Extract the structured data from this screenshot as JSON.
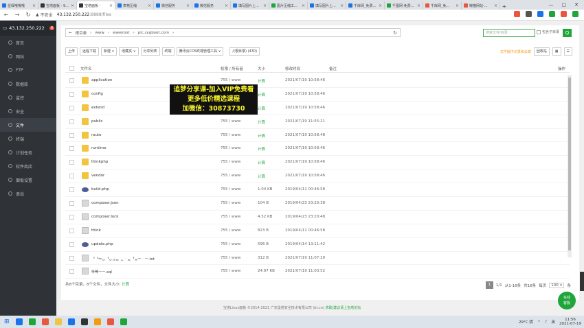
{
  "browser": {
    "tabs": [
      {
        "title": "星辉哦哦哦",
        "color": "#1a73e8"
      },
      {
        "title": "宝塔面板 - 9...",
        "color": "#333333"
      },
      {
        "title": "宝塔面板 - ",
        "color": "#333333",
        "active": true
      },
      {
        "title": "表格压缩",
        "color": "#1a73e8"
      },
      {
        "title": "微信服务",
        "color": "#1a73e8"
      },
      {
        "title": "微信服务",
        "color": "#1a73e8"
      },
      {
        "title": "填写图片上...",
        "color": "#1a73e8"
      },
      {
        "title": "图片压缩工...",
        "color": "#20a53a"
      },
      {
        "title": "填写图片上...",
        "color": "#1a73e8"
      },
      {
        "title": "千库网_免费...",
        "color": "#1a73e8"
      },
      {
        "title": "千图网-免费...",
        "color": "#20a53a"
      },
      {
        "title": "千库网_免...",
        "color": "#e9573f"
      },
      {
        "title": "懒猫网站-...",
        "color": "#e9573f"
      }
    ],
    "new_tab": "+",
    "win": {
      "min": "—",
      "max": "▢",
      "close": "✕"
    },
    "insecure_label": "不安全",
    "url_host": "43.132.250.222",
    "url_rest": ":8888/files",
    "ext_colors": [
      "#e9573f",
      "#555555",
      "#1a73e8",
      "#20a53a",
      "#e9573f",
      "#20a53a"
    ]
  },
  "sidebar": {
    "server": "43.132.250.222",
    "badge": "0",
    "items": [
      {
        "label": "首页"
      },
      {
        "label": "网站"
      },
      {
        "label": "FTP"
      },
      {
        "label": "数据库"
      },
      {
        "label": "监控"
      },
      {
        "label": "安全"
      },
      {
        "label": "文件",
        "active": true
      },
      {
        "label": "终端"
      },
      {
        "label": "计划任务"
      },
      {
        "label": "软件商店"
      },
      {
        "label": "面板设置"
      },
      {
        "label": "退出"
      }
    ]
  },
  "path": {
    "back": "←",
    "segments": [
      "根目录",
      "www",
      "wwwroot",
      "pic.zygboot.com"
    ],
    "sep": "›",
    "refresh": "↻"
  },
  "search": {
    "placeholder": "搜索文件/目录",
    "subdir_label": "包含子目录",
    "btn": "Q"
  },
  "toolbar": {
    "buttons": [
      "上传",
      "远程下载",
      "新建 ∨",
      "收藏夹 ∨",
      "分享列表",
      "终端",
      "腾讯云COS终端管理工具 ∨",
      "/(根目录) (430)"
    ],
    "fav_link": "文件操作记录和云端",
    "recycle": "回收站",
    "view_grid": "▦",
    "view_list": "☰"
  },
  "columns": {
    "name": "文件名",
    "perm": "权限 / 所有者",
    "size": "大小",
    "mtime": "修改时间",
    "note": "备注",
    "ops": "操作"
  },
  "files": [
    {
      "name": "application",
      "type": "folder",
      "perm": "755 / www",
      "size": "计算",
      "mtime": "2021/07/19 10:58:46"
    },
    {
      "name": "config",
      "type": "folder",
      "perm": "755 / www",
      "size": "计算",
      "mtime": "2021/07/19 10:58:46"
    },
    {
      "name": "extend",
      "type": "folder",
      "perm": "755 / www",
      "size": "计算",
      "mtime": "2021/07/19 10:58:46"
    },
    {
      "name": "public",
      "type": "folder",
      "perm": "755 / www",
      "size": "计算",
      "mtime": "2021/07/19 11:55:21"
    },
    {
      "name": "route",
      "type": "folder",
      "perm": "755 / www",
      "size": "计算",
      "mtime": "2021/07/19 10:58:48"
    },
    {
      "name": "runtime",
      "type": "folder",
      "perm": "755 / www",
      "size": "计算",
      "mtime": "2021/07/19 10:58:46"
    },
    {
      "name": "thinkphp",
      "type": "folder",
      "perm": "755 / www",
      "size": "计算",
      "mtime": "2021/07/19 10:58:46"
    },
    {
      "name": "vendor",
      "type": "folder",
      "perm": "755 / www",
      "size": "计算",
      "mtime": "2021/07/19 10:58:46"
    },
    {
      "name": "build.php",
      "type": "php",
      "perm": "755 / www",
      "size": "1.04 KB",
      "mtime": "2019/04/11 00:46:58"
    },
    {
      "name": "composer.json",
      "type": "file",
      "perm": "755 / www",
      "size": "104 B",
      "mtime": "2019/04/23 23:20:38"
    },
    {
      "name": "composer.lock",
      "type": "file",
      "perm": "755 / www",
      "size": "4.52 KB",
      "mtime": "2019/04/23 23:20:48"
    },
    {
      "name": "think",
      "type": "file",
      "perm": "755 / www",
      "size": "823 B",
      "mtime": "2019/04/11 00:46:58"
    },
    {
      "name": "update.php",
      "type": "php",
      "perm": "755 / www",
      "size": "596 B",
      "mtime": "2019/04/14 13:11:42"
    },
    {
      "name": "ᅡᅧᆃᆼᅥᆼᆭᆮ ᆫᆞᆮᅥᆾᅮᆞᅳ.txt",
      "type": "file",
      "perm": "755 / www",
      "size": "312 B",
      "mtime": "2021/07/19 11:07:20"
    },
    {
      "name": "ᅆᅡ빠ᅳᅳ.sql",
      "type": "file",
      "perm": "755 / www",
      "size": "24.97 KB",
      "mtime": "2021/07/19 11:03:52"
    }
  ],
  "footer": {
    "summary": "共8个目录，8个文件，文件大小: ",
    "calc": "计算",
    "page_current": "1",
    "page_total": "1/1",
    "range": "从1-16条",
    "count": "共16条",
    "per_page_label": "每页",
    "per_page": "100 ∨",
    "unit": "条"
  },
  "copyright": {
    "text": "宝塔Linux面板 ©2014-2021 广东堡塔安全技术有限公司 (bt.cn)",
    "link": "求助|建议请上宝塔论坛"
  },
  "promo": {
    "line1": "追梦分享课-加入VIP免费看",
    "line2": "更多低价精选课程",
    "line3": "加微信：30873730"
  },
  "online": {
    "line1": "在线",
    "line2": "客服"
  },
  "taskbar": {
    "icons": [
      "#1a73e8",
      "#20a53a",
      "#e9573f",
      "#f3c441",
      "#1a73e8",
      "#333333",
      "#f39c12",
      "#e9573f",
      "#20a53a"
    ],
    "temp": "29°C 阴",
    "lang": "英",
    "time": "11:56",
    "date": "2021-07-19"
  }
}
